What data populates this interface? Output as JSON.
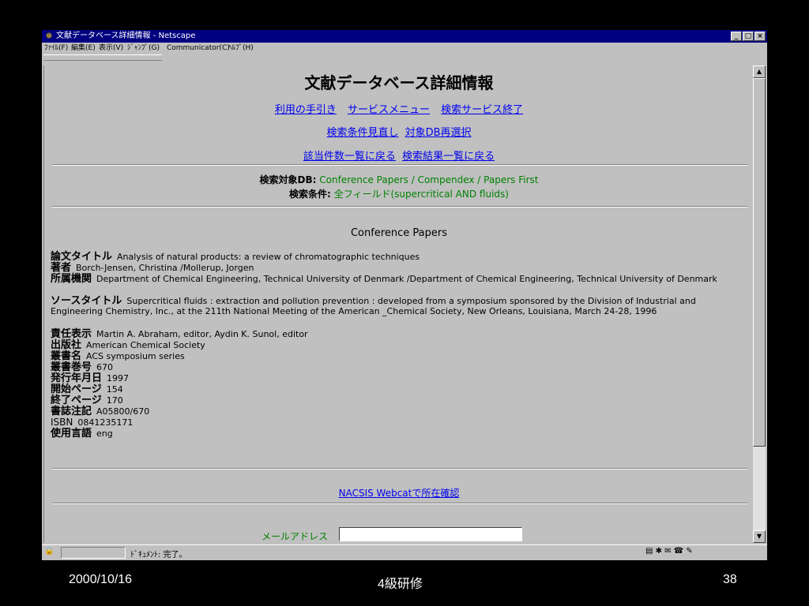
{
  "window": {
    "title": "文献データベース詳細情報 - Netscape",
    "menu": [
      "ﾌｧｲﾙ(F)",
      "編集(E)",
      "表示(V)",
      "ｼﾞｬﾝﾌﾟ(G)",
      "Communicator(C)",
      "ﾍﾙﾌﾟ(H)"
    ]
  },
  "page": {
    "title": "文献データベース詳細情報",
    "nav_row1": [
      "利用の手引き",
      "サービスメニュー",
      "検索サービス終了"
    ],
    "nav_row2": [
      "検索条件見直し",
      "対象DB再選択"
    ],
    "nav_row3": [
      "該当件数一覧に戻る",
      "検索結果一覧に戻る"
    ],
    "search_db_label": "検索対象DB:",
    "search_db_value": "Conference Papers / Compendex / Papers First",
    "search_cond_label": "検索条件:",
    "search_cond_value": "全フィールド(supercritical AND fluids)",
    "section_heading": "Conference Papers",
    "record": {
      "title_label": "論文タイトル",
      "title_value": "Analysis of natural products: a review of chromatographic techniques",
      "author_label": "著者",
      "author_value": "Borch-Jensen, Christina /Mollerup, Jorgen",
      "affil_label": "所属機関",
      "affil_value": "Department of Chemical Engineering, Technical University of Denmark /Department of Chemical Engineering, Technical University of Denmark",
      "source_label": "ソースタイトル",
      "source_value": "Supercritical fluids : extraction and pollution prevention : developed from a symposium sponsored by the Division of Industrial and Engineering Chemistry, Inc., at the 211th National Meeting of the American _Chemical Society, New Orleans, Louisiana, March 24-28, 1996",
      "resp_label": "責任表示",
      "resp_value": "Martin A. Abraham, editor, Aydin K. Sunol, editor",
      "publisher_label": "出版社",
      "publisher_value": "American Chemical Society",
      "series_label": "叢書名",
      "series_value": "ACS symposium series",
      "seriesno_label": "叢書巻号",
      "seriesno_value": "670",
      "date_label": "発行年月日",
      "date_value": "1997",
      "start_label": "開始ページ",
      "start_value": "154",
      "end_label": "終了ページ",
      "end_value": "170",
      "biblio_label": "書誌注記",
      "biblio_value": "A05800/670",
      "isbn_label": "ISBN",
      "isbn_value": "0841235171",
      "lang_label": "使用言語",
      "lang_value": "eng"
    },
    "webcat_link": "NACSIS Webcatで所在確認",
    "mail_label": "メールアドレス",
    "mail_value": ""
  },
  "status": {
    "text": "ﾄﾞｷｭﾒﾝﾄ: 完了。"
  },
  "slide_footer": {
    "date": "2000/10/16",
    "center": "4級研修",
    "page_no": "38"
  }
}
